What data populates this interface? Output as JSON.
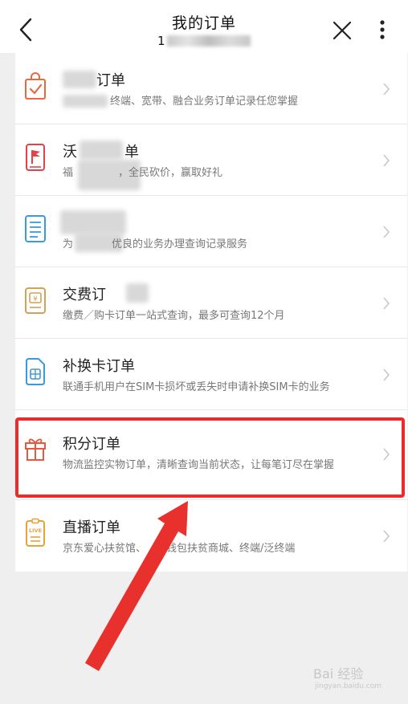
{
  "header": {
    "title": "我的订单",
    "subtitle": "1"
  },
  "orders": [
    {
      "icon": "shopping-bag-icon",
      "name": "订单",
      "desc": "终端、宽带、融合业务订单记录任您掌握"
    },
    {
      "icon": "flag-icon",
      "name": "沃",
      "name_suffix": "单",
      "desc": "福",
      "desc_suffix": "，全民砍价，赢取好礼"
    },
    {
      "icon": "document-list-icon",
      "name": "",
      "desc": "为",
      "desc_suffix": "优良的业务办理查询记录服务"
    },
    {
      "icon": "payment-bag-icon",
      "name": "交费订",
      "desc": "缴费／购卡订单一站式查询，最多可查询12个月"
    },
    {
      "icon": "sim-card-icon",
      "name": "补换卡订单",
      "desc": "联通手机用户在SIM卡损坏或丢失时申请补换SIM卡的业务"
    },
    {
      "icon": "gift-icon",
      "name": "积分订单",
      "desc": "物流监控实物订单，清晰查询当前状态，让每笔订尽在掌握"
    },
    {
      "icon": "live-icon",
      "icon_text": "LIVE",
      "name": "直播订单",
      "desc": "京东爱心扶贫馆、",
      "desc_suffix": "钱包扶贫商城、终端/泛终端"
    }
  ],
  "watermark": {
    "text": "Bai 经验",
    "sub": "jingyan.baidu.com"
  },
  "colors": {
    "highlight": "#ec2b2b",
    "arrow": "#e8302c",
    "accent": "#e55a3c"
  }
}
